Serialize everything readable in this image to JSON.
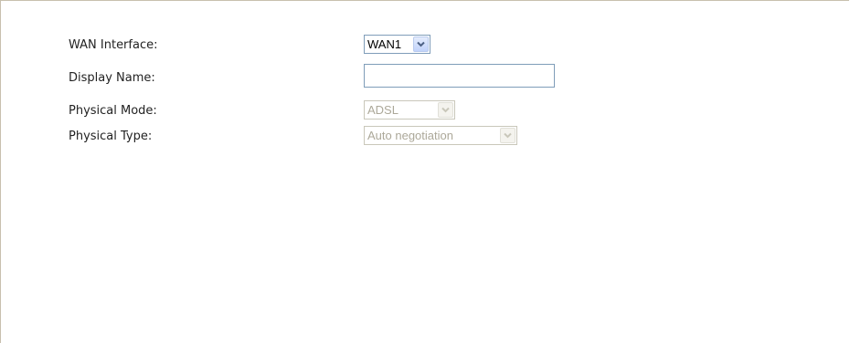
{
  "form": {
    "wan_interface": {
      "label": "WAN Interface:",
      "value": "WAN1"
    },
    "display_name": {
      "label": "Display Name:",
      "value": "",
      "placeholder": ""
    },
    "physical_mode": {
      "label": "Physical Mode:",
      "value": "ADSL",
      "disabled": true
    },
    "physical_type": {
      "label": "Physical Type:",
      "value": "Auto negotiation",
      "disabled": true
    }
  },
  "icons": {
    "dropdown": "chevron-down-icon"
  },
  "colors": {
    "border": "#7f9db9",
    "disabled_text": "#aca899",
    "panel_border": "#c8c0ae"
  }
}
